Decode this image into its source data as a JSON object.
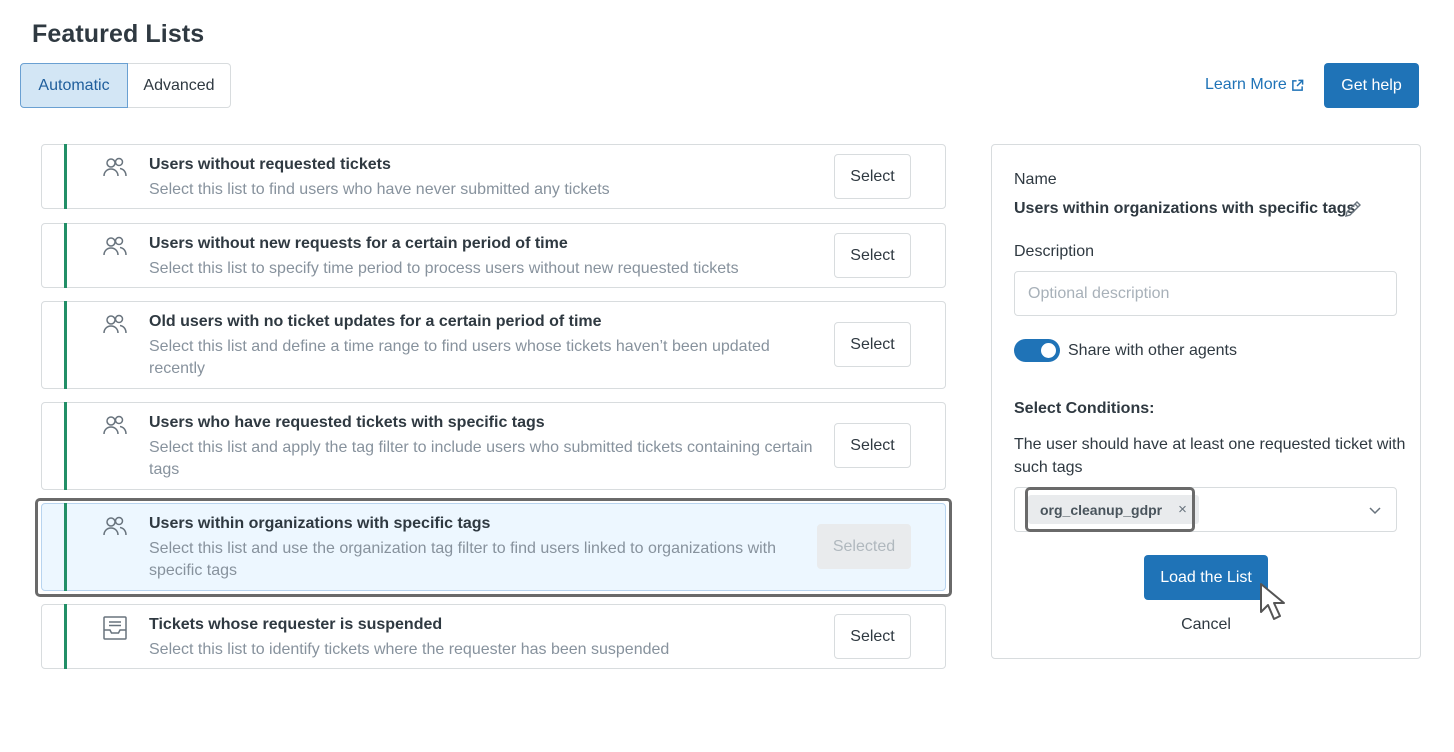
{
  "header": {
    "title": "Featured Lists",
    "tabs": [
      {
        "label": "Automatic",
        "active": true
      },
      {
        "label": "Advanced",
        "active": false
      }
    ],
    "learn_more": "Learn More",
    "get_help": "Get help"
  },
  "lists": [
    {
      "title": "Users without requested tickets",
      "description": "Select this list to find users who have never submitted any tickets",
      "button": "Select",
      "icon": "users-icon"
    },
    {
      "title": "Users without new requests for a certain period of time",
      "description": "Select this list to specify time period to process users without new requested tickets",
      "button": "Select",
      "icon": "users-icon"
    },
    {
      "title": "Old users with no ticket updates for a certain period of time",
      "description": "Select this list and define a time range to find users whose tickets haven’t been updated recently",
      "button": "Select",
      "icon": "users-icon"
    },
    {
      "title": "Users who have requested tickets with specific tags",
      "description": "Select this list and apply the tag filter to include users who submitted tickets containing certain tags",
      "button": "Select",
      "icon": "users-icon"
    },
    {
      "title": "Users within organizations with specific tags",
      "description": "Select this list and use the organization tag filter to find users linked to organizations with specific tags",
      "button": "Selected",
      "icon": "users-icon",
      "selected": true
    },
    {
      "title": "Tickets whose requester is suspended",
      "description": "Select this list to identify tickets where the requester has been suspended",
      "button": "Select",
      "icon": "inbox-icon"
    }
  ],
  "panel": {
    "name_label": "Name",
    "name_value": "Users within organizations with specific tags",
    "description_label": "Description",
    "description_placeholder": "Optional description",
    "description_value": "",
    "share_label": "Share with other agents",
    "share_enabled": true,
    "conditions_title": "Select Conditions:",
    "conditions_text": "The user should have at least one requested ticket with such tags",
    "tags": [
      "org_cleanup_gdpr"
    ],
    "tag_remove": "×",
    "load_button": "Load the List",
    "cancel": "Cancel"
  },
  "colors": {
    "primary": "#1f73b7",
    "accent_bar": "#228f67",
    "selected_bg": "#edf7ff"
  }
}
